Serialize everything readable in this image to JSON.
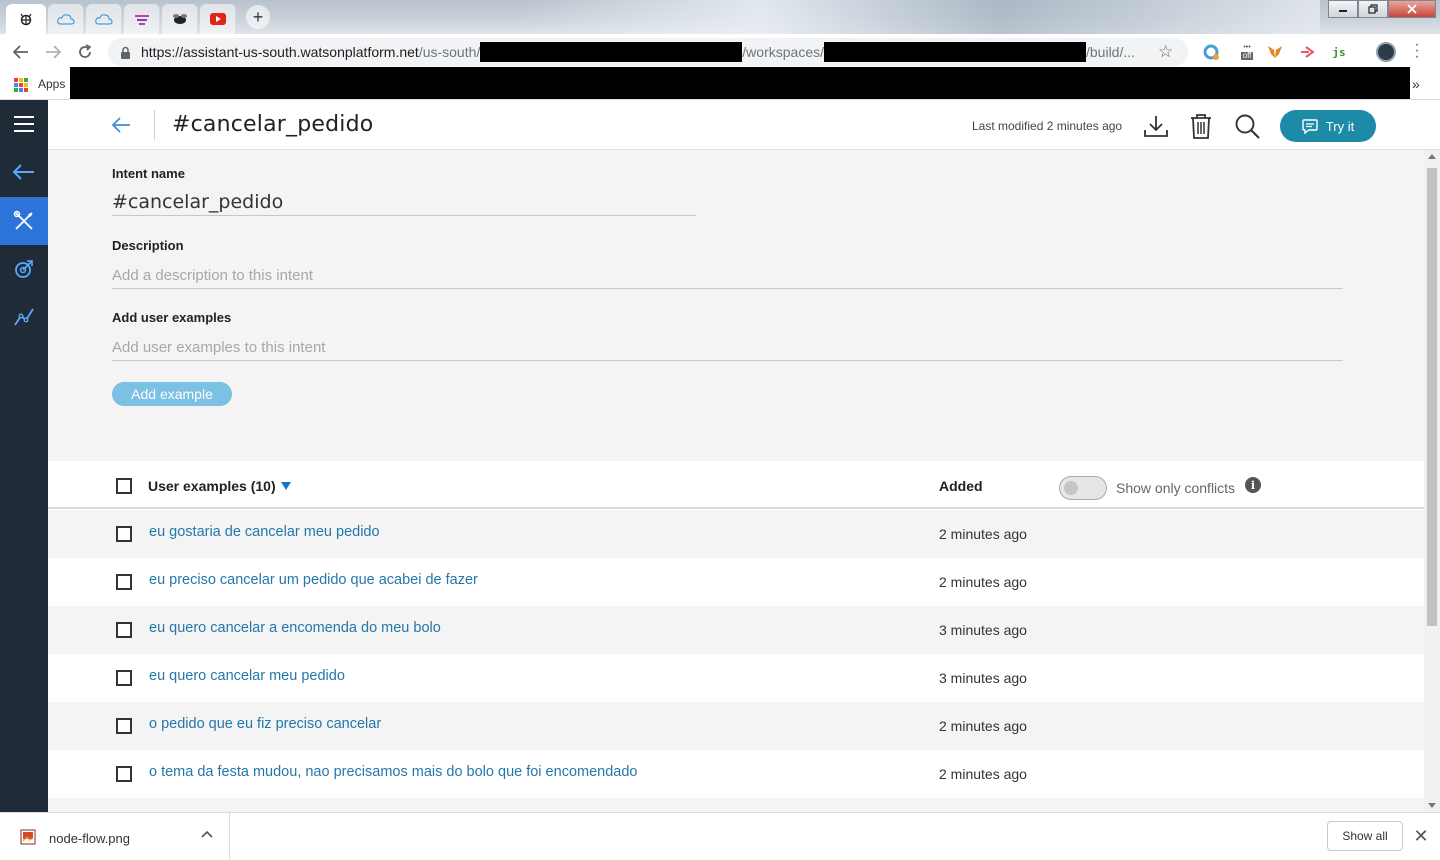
{
  "browser": {
    "tabs": [
      {
        "icon": "ibm-bee-icon",
        "active": true
      },
      {
        "icon": "cloud-icon",
        "active": false
      },
      {
        "icon": "cloud-icon",
        "active": false
      },
      {
        "icon": "extension-icon",
        "active": false
      },
      {
        "icon": "bee-icon",
        "active": false
      },
      {
        "icon": "youtube-icon",
        "active": false
      }
    ],
    "new_tab_symbol": "+",
    "url_parts": {
      "host": "https://assistant-us-south.watsonplatform.net",
      "path1": "/us-south/",
      "path2": "/workspaces/",
      "path3": "/build/..."
    },
    "bookmarks": {
      "apps_label": "Apps",
      "more_symbol": "»"
    },
    "extension_badges": {
      "off": "off",
      "js": "js"
    }
  },
  "header": {
    "title": "#cancelar_pedido",
    "last_modified": "Last modified 2 minutes ago",
    "try_label": "Try it"
  },
  "form": {
    "intent_name_label": "Intent name",
    "intent_name_value": "#cancelar_pedido",
    "description_label": "Description",
    "description_placeholder": "Add a description to this intent",
    "examples_label": "Add user examples",
    "examples_placeholder": "Add user examples to this intent",
    "add_example_label": "Add example"
  },
  "table": {
    "header_examples": "User examples (10)",
    "header_added": "Added",
    "conflicts_label": "Show only conflicts",
    "info_symbol": "i",
    "rows": [
      {
        "text": "eu gostaria de cancelar meu pedido",
        "added": "2 minutes ago"
      },
      {
        "text": "eu preciso cancelar um pedido que acabei de fazer",
        "added": "2 minutes ago"
      },
      {
        "text": "eu quero cancelar a encomenda do meu bolo",
        "added": "3 minutes ago"
      },
      {
        "text": "eu quero cancelar meu pedido",
        "added": "3 minutes ago"
      },
      {
        "text": "o pedido que eu fiz preciso cancelar",
        "added": "2 minutes ago"
      },
      {
        "text": "o tema da festa mudou, nao precisamos mais do bolo que foi encomendado",
        "added": "2 minutes ago"
      }
    ]
  },
  "download": {
    "file_name": "node-flow.png",
    "show_all_label": "Show all",
    "close_symbol": "✕"
  },
  "colors": {
    "rail": "#1f2b36",
    "rail_active": "#2d74da",
    "accent": "#1d8ba8",
    "link": "#2378ab",
    "add_button": "#7cc0e3"
  }
}
